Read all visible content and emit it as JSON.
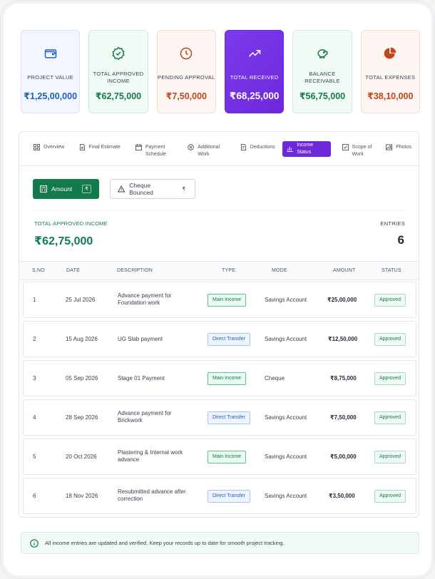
{
  "cards": [
    {
      "label": "PROJECT VALUE",
      "value": "₹1,25,00,000",
      "icon": "wallet-icon"
    },
    {
      "label": "TOTAL APPROVED INCOME",
      "value": "₹62,75,000",
      "icon": "check-badge-icon"
    },
    {
      "label": "PENDING APPROVAL",
      "value": "₹7,50,000",
      "icon": "clock-icon"
    },
    {
      "label": "TOTAL RECEIVED",
      "value": "₹68,25,000",
      "icon": "trend-up-icon"
    },
    {
      "label": "BALANCE RECEIVABLE",
      "value": "₹56,75,000",
      "icon": "piggy-bank-icon"
    },
    {
      "label": "TOTAL EXPENSES",
      "value": "₹38,10,000",
      "icon": "pie-chart-icon"
    }
  ],
  "tabs": [
    {
      "label": "Overview",
      "icon": "grid-icon"
    },
    {
      "label": "Final Estimate",
      "icon": "document-icon"
    },
    {
      "label": "Payment Schedule",
      "icon": "calendar-icon"
    },
    {
      "label": "Additional Work",
      "icon": "plus-circle-icon"
    },
    {
      "label": "Deductions",
      "icon": "receipt-icon"
    },
    {
      "label": "Income Status",
      "icon": "bar-chart-icon"
    },
    {
      "label": "Scope of Work",
      "icon": "checklist-icon"
    },
    {
      "label": "Photos",
      "icon": "image-icon"
    }
  ],
  "filters": {
    "amount_label": "Amount",
    "amount_chip": "₹",
    "bounced_label": "Cheque Bounced",
    "bounced_chip": "₹"
  },
  "summary": {
    "total_label": "TOTAL APPROVED INCOME",
    "total_value": "₹62,75,000",
    "entries_label": "ENTRIES",
    "entries_value": "6"
  },
  "table": {
    "headers": {
      "sno": "S.NO",
      "date": "DATE",
      "description": "DESCRIPTION",
      "type": "TYPE",
      "mode": "MODE",
      "amount": "AMOUNT",
      "status": "STATUS"
    },
    "rows": [
      {
        "sno": "1",
        "date": "25 Jul 2026",
        "description": "Advance payment for Foundation work",
        "type": "Main Income",
        "mode": "Savings Account",
        "amount": "₹25,00,000",
        "status": "Approved"
      },
      {
        "sno": "2",
        "date": "15 Aug 2026",
        "description": "UG Slab payment",
        "type": "Direct Transfer",
        "mode": "Savings Account",
        "amount": "₹12,50,000",
        "status": "Approved"
      },
      {
        "sno": "3",
        "date": "05 Sep 2026",
        "description": "Stage 01 Payment",
        "type": "Main Income",
        "mode": "Cheque",
        "amount": "₹8,75,000",
        "status": "Approved"
      },
      {
        "sno": "4",
        "date": "28 Sep 2026",
        "description": "Advance payment for Brickwork",
        "type": "Direct Transfer",
        "mode": "Savings Account",
        "amount": "₹7,50,000",
        "status": "Approved"
      },
      {
        "sno": "5",
        "date": "20 Oct 2026",
        "description": "Plastering & Internal work advance",
        "type": "Main Income",
        "mode": "Savings Account",
        "amount": "₹5,00,000",
        "status": "Approved"
      },
      {
        "sno": "6",
        "date": "18 Nov 2026",
        "description": "Resubmitted advance after correction",
        "type": "Direct Transfer",
        "mode": "Savings Account",
        "amount": "₹3,50,000",
        "status": "Approved"
      }
    ]
  },
  "footer": {
    "text": "All income entries are updated and verified. Keep your records up to date for smooth project tracking.",
    "icon": "info-icon"
  },
  "colors": {
    "accent": "#6d28d9",
    "success": "#137a4c",
    "info": "#1d5fbf",
    "warning": "#c0461b"
  }
}
